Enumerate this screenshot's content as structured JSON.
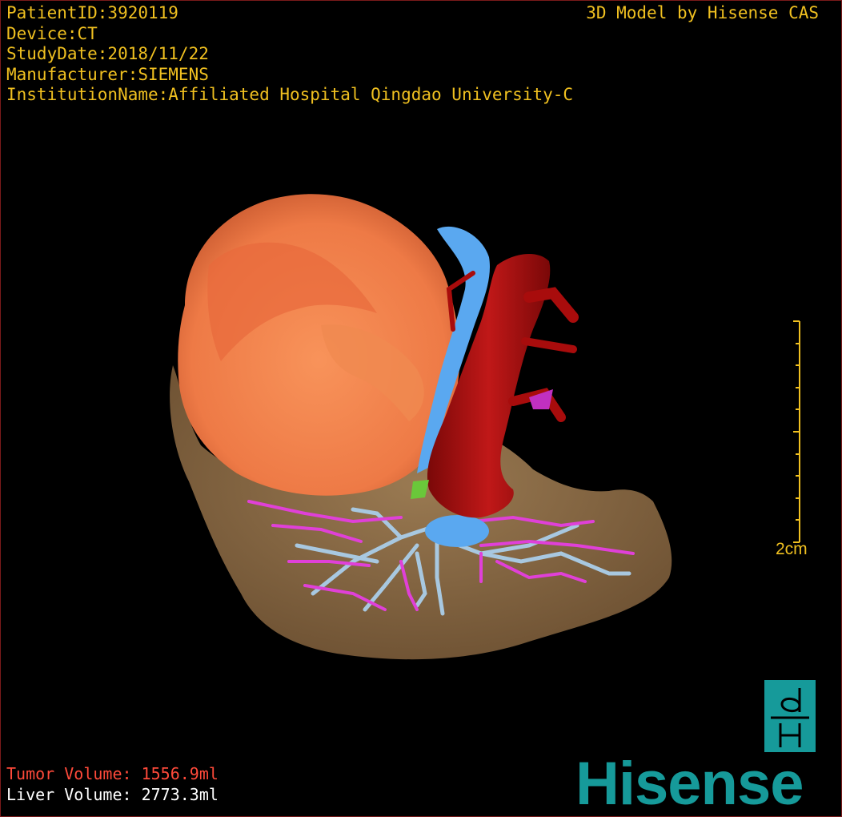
{
  "header": {
    "patient_id": "PatientID:3920119",
    "device": "Device:CT",
    "study_date": "StudyDate:2018/11/22",
    "manufacturer": "Manufacturer:SIEMENS",
    "institution": "InstitutionName:Affiliated Hospital Qingdao University-C",
    "credit": "3D Model by Hisense CAS"
  },
  "scale": {
    "label": "2cm"
  },
  "volumes": {
    "tumor": "Tumor Volume: 1556.9ml",
    "liver": "Liver Volume: 2773.3ml"
  },
  "brand": {
    "name": "Hisense",
    "badge_icon": "dH-logo-icon"
  },
  "colors": {
    "text_info": "#f0c020",
    "tumor_text": "#ff4a3a",
    "liver": "#8a6a44",
    "tumor": "#f0804a",
    "artery": "#a80c0c",
    "portal_vein": "#e040d8",
    "hepatic_vein": "#a8c8e0",
    "ivc": "#5aa8f0",
    "brand": "#169a9a"
  }
}
